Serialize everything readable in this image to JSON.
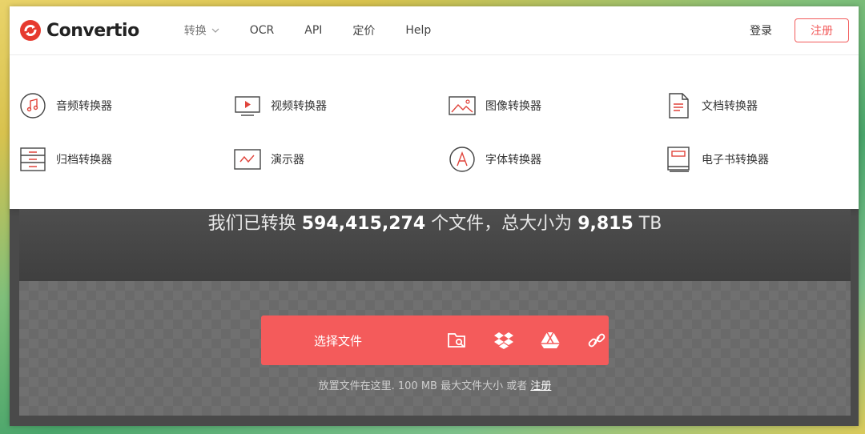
{
  "app": {
    "logo_text": "Convertio"
  },
  "nav": {
    "items": [
      {
        "label": "转换",
        "has_dropdown": true
      },
      {
        "label": "OCR"
      },
      {
        "label": "API"
      },
      {
        "label": "定价"
      },
      {
        "label": "Help"
      }
    ],
    "login_label": "登录",
    "signup_label": "注册"
  },
  "menu": {
    "items": [
      {
        "label": "音频转换器",
        "icon": "music-note-icon"
      },
      {
        "label": "视频转换器",
        "icon": "video-play-icon"
      },
      {
        "label": "图像转换器",
        "icon": "image-icon"
      },
      {
        "label": "文档转换器",
        "icon": "document-icon"
      },
      {
        "label": "归档转换器",
        "icon": "archive-icon"
      },
      {
        "label": "演示器",
        "icon": "presentation-icon"
      },
      {
        "label": "字体转换器",
        "icon": "font-icon"
      },
      {
        "label": "电子书转换器",
        "icon": "ebook-icon"
      }
    ]
  },
  "hero": {
    "stats_prefix": "我们已转换",
    "files_count": "594,415,274",
    "stats_mid": "个文件，总大小为",
    "total_size": "9,815",
    "size_unit": "TB"
  },
  "upload": {
    "choose_label": "选择文件",
    "sources": [
      "folder-search-icon",
      "dropbox-icon",
      "google-drive-icon",
      "link-icon"
    ],
    "hint_text": "放置文件在这里. 100 MB 最大文件大小 或者",
    "hint_link": "注册"
  },
  "colors": {
    "accent": "#f45b5b",
    "icon_red": "#e0443b",
    "hero_dark": "#4a4a4a"
  }
}
